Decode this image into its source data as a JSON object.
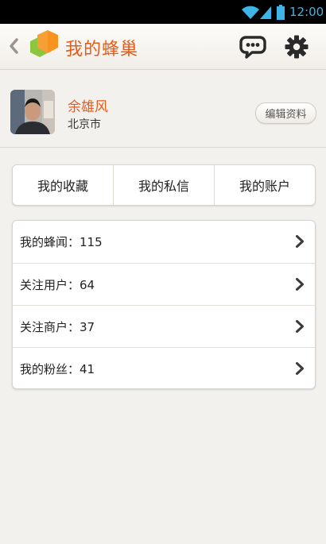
{
  "status_bar": {
    "time": "12:00",
    "icons": [
      "wifi-icon",
      "signal-icon",
      "battery-icon"
    ],
    "accent_color": "#3fb4e6"
  },
  "header": {
    "title": "我的蜂巢",
    "back_icon": "chevron-left-icon",
    "logo_icon": "hexagon-logo-icon",
    "message_icon": "chat-bubble-icon",
    "settings_icon": "gear-icon",
    "title_color": "#e55b1b"
  },
  "profile": {
    "name": "余雄风",
    "city": "北京市",
    "edit_label": "编辑资料"
  },
  "tabs": [
    {
      "label": "我的收藏"
    },
    {
      "label": "我的私信"
    },
    {
      "label": "我的账户"
    }
  ],
  "stats": [
    {
      "label": "我的蜂闻：115"
    },
    {
      "label": "关注用户：64"
    },
    {
      "label": "关注商户：37"
    },
    {
      "label": "我的粉丝：41"
    }
  ]
}
